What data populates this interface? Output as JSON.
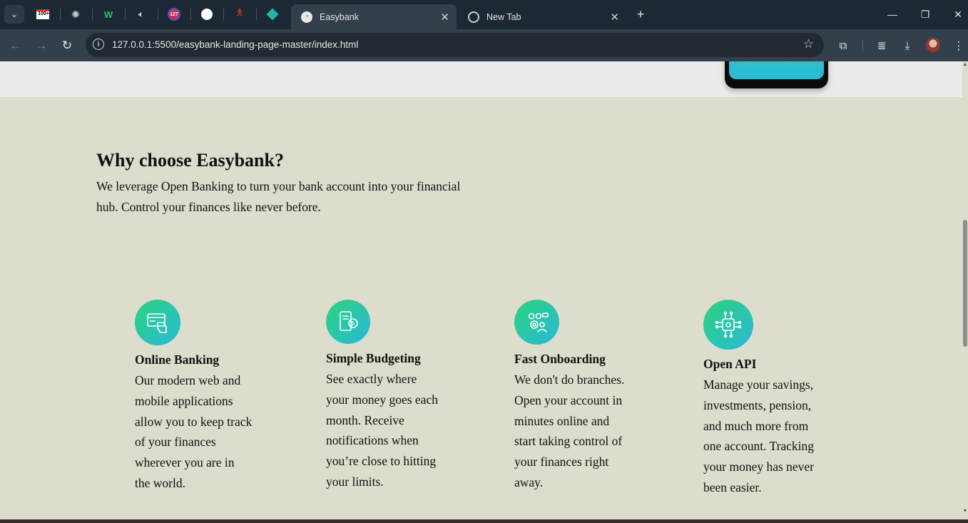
{
  "browser": {
    "tabs": [
      {
        "label": "Easybank",
        "active": true
      },
      {
        "label": "New Tab",
        "active": false
      }
    ],
    "pinned_tabs": [
      "gmail-icon",
      "openai-icon",
      "webflow-icon",
      "speaker-icon",
      "counter-badge-icon",
      "github-icon",
      "figure-icon",
      "diamond-icon"
    ],
    "gmail_badge": "100+",
    "counter_badge": "127",
    "url": "127.0.0.1:5500/easybank-landing-page-master/index.html"
  },
  "page": {
    "section_title": "Why choose Easybank?",
    "section_intro": "We leverage Open Banking to turn your bank account into your financial hub. Control your finances like never before.",
    "features": [
      {
        "title": "Online Banking",
        "text": "Our modern web and mobile applications allow you to keep track of your finances wherever you are in the world.",
        "icon": "online-banking-icon"
      },
      {
        "title": "Simple Budgeting",
        "text": "See exactly where your money goes each month. Receive notifications when you’re close to hitting your limits.",
        "icon": "budgeting-icon"
      },
      {
        "title": "Fast Onboarding",
        "text": "We don't do branches. Open your account in minutes online and start taking control of your finances right away.",
        "icon": "onboarding-icon"
      },
      {
        "title": "Open API",
        "text": "Manage your savings, investments, pension, and much more from one account. Tracking your money has never been easier.",
        "icon": "api-icon"
      }
    ]
  },
  "colors": {
    "background": "#dcddcc",
    "icon_gradient_start": "#2bd37d",
    "icon_gradient_end": "#2bb8d8"
  }
}
